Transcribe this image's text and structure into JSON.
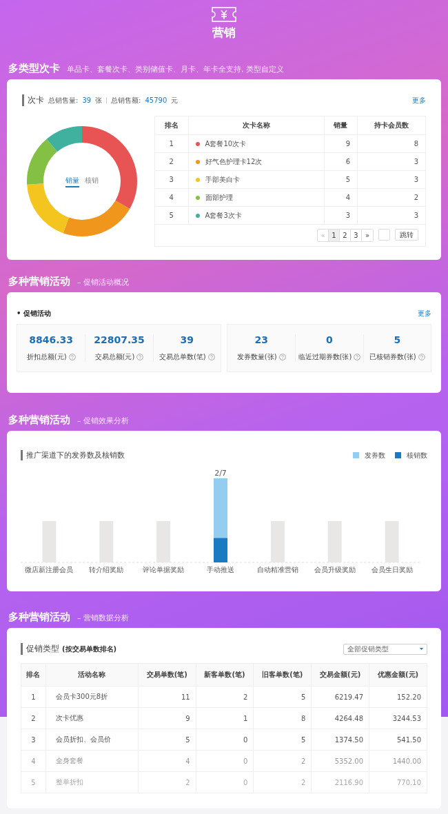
{
  "header": {
    "title": "营销"
  },
  "card_section": {
    "title": "多类型次卡",
    "subtitle": "单品卡、套餐次卡、类别储值卡、月卡、年卡全支持, 类型自定义",
    "panel_title": "次卡",
    "stat1_label": "总销售量:",
    "stat1_value": "39",
    "stat1_unit": "张",
    "stat2_label": "总销售额:",
    "stat2_value": "45790",
    "stat2_unit": "元",
    "more": "更多",
    "donut_tabs": [
      {
        "label": "销量",
        "selected": true
      },
      {
        "label": "核销",
        "selected": false
      }
    ],
    "columns": [
      "排名",
      "次卡名称",
      "销量",
      "持卡会员数"
    ],
    "rows": [
      {
        "rank": "1",
        "name": "A套餐10次卡",
        "color": "#e85454",
        "sales": "9",
        "members": "8"
      },
      {
        "rank": "2",
        "name": "好气色护理卡12次",
        "color": "#f0961c",
        "sales": "6",
        "members": "3"
      },
      {
        "rank": "3",
        "name": "手部美白卡",
        "color": "#f5c51f",
        "sales": "5",
        "members": "3"
      },
      {
        "rank": "4",
        "name": "面部护理",
        "color": "#84c044",
        "sales": "4",
        "members": "2"
      },
      {
        "rank": "5",
        "name": "A套餐3次卡",
        "color": "#40b09f",
        "sales": "3",
        "members": "3"
      }
    ],
    "pagination": {
      "prev": {
        "label": "«",
        "disabled": true
      },
      "pages": [
        {
          "label": "1",
          "selected": true
        },
        {
          "label": "2",
          "selected": false
        },
        {
          "label": "3",
          "selected": false
        }
      ],
      "next": {
        "label": "»",
        "disabled": false
      },
      "jump": "跳转"
    }
  },
  "promo_overview": {
    "title": "多种营销活动",
    "subtitle": "– 促销活动概况",
    "panel_title": "• 促销活动",
    "more": "更多",
    "groups": [
      [
        {
          "value": "8846.33",
          "label": "折扣总额(元)"
        },
        {
          "value": "22807.35",
          "label": "交易总额(元)"
        },
        {
          "value": "39",
          "label": "交易总单数(笔)"
        }
      ],
      [
        {
          "value": "23",
          "label": "发券数量(张)"
        },
        {
          "value": "0",
          "label": "临近过期券数(张)"
        },
        {
          "value": "5",
          "label": "已核销券数(张)"
        }
      ]
    ]
  },
  "effect_analysis": {
    "title": "多种营销活动",
    "subtitle": "– 促销效果分析",
    "panel_title": "推广渠道下的发券数及核销数",
    "legend": [
      {
        "name": "发券数",
        "color": "#95cdf0"
      },
      {
        "name": "核销数",
        "color": "#1a7bc2"
      }
    ],
    "channels": [
      {
        "label": "微店新注册会员",
        "kind": "empty"
      },
      {
        "label": "转介绍奖励",
        "kind": "empty"
      },
      {
        "label": "评论单据奖励",
        "kind": "empty"
      },
      {
        "label": "手动推送",
        "kind": "filled",
        "value_label": "2/7",
        "level": 0.29
      },
      {
        "label": "自动精准营销",
        "kind": "empty"
      },
      {
        "label": "会员升级奖励",
        "kind": "empty"
      },
      {
        "label": "会员生日奖励",
        "kind": "empty"
      }
    ]
  },
  "data_analysis": {
    "title": "多种营销活动",
    "subtitle": "– 营销数据分析",
    "panel_title": "促销类型",
    "panel_note": "(按交易单数排名)",
    "filter": "全部促销类型",
    "columns": [
      "排名",
      "活动名称",
      "交易单数(笔)",
      "新客单数(笔)",
      "旧客单数(笔)",
      "交易金额(元)",
      "优惠金额(元)"
    ],
    "rows": [
      [
        "1",
        "会员卡300元8折",
        "11",
        "2",
        "5",
        "6219.47",
        "152.20"
      ],
      [
        "2",
        "次卡优惠",
        "9",
        "1",
        "8",
        "4264.48",
        "3244.53"
      ],
      [
        "3",
        "会员折扣、会员价",
        "5",
        "0",
        "5",
        "1374.50",
        "541.50"
      ],
      [
        "4",
        "全身套餐",
        "4",
        "0",
        "2",
        "5352.00",
        "1440.00"
      ],
      [
        "5",
        "整单折扣",
        "2",
        "0",
        "2",
        "2116.90",
        "770.10"
      ]
    ]
  }
}
